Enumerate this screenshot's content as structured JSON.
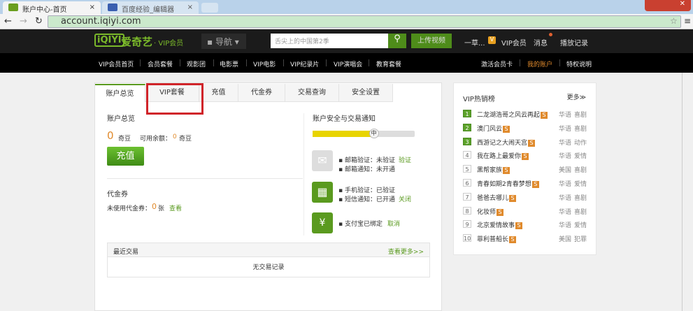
{
  "browser": {
    "tabs": [
      {
        "title": "账户中心-首页",
        "close": "×"
      },
      {
        "title": "百度经验_编辑器",
        "close": "×"
      }
    ],
    "url": "account.iqiyi.com"
  },
  "header": {
    "logo": "iQIYI",
    "brand": "爱奇艺",
    "vip": "· VIP会员",
    "nav_menu": "导航",
    "search_placeholder": "舌尖上的中国第2季",
    "upload": "上传视频",
    "user": "一草...",
    "vip_link": "VIP会员",
    "messages": "消息",
    "history": "播放记录"
  },
  "nav": {
    "items": [
      "VIP会员首页",
      "会员套餐",
      "观影团",
      "电影票",
      "VIP电影",
      "VIP纪录片",
      "VIP演唱会",
      "教育套餐"
    ],
    "right": [
      "激活会员卡",
      "我的账户",
      "特权说明"
    ]
  },
  "tabs": [
    "账户总览",
    "VIP套餐",
    "充值",
    "代金券",
    "交易查询",
    "安全设置"
  ],
  "overview": {
    "title": "账户总览",
    "balance": "0",
    "unit": "奇豆",
    "available_label": "可用余额：",
    "available": "0",
    "available_unit": "奇豆",
    "recharge": "充值"
  },
  "voucher": {
    "title": "代金券",
    "label": "未使用代金券：",
    "count": "0",
    "unit": "张",
    "view": "查看"
  },
  "security": {
    "title": "账户安全与交易通知",
    "level": "中",
    "level_pct": 60,
    "items": [
      [
        "邮箱验证：未验证",
        "邮箱通知：未开通"
      ],
      [
        "手机验证：已验证",
        "短信通知：已开通"
      ],
      [
        "支付宝已绑定"
      ]
    ],
    "actions": [
      "验证",
      "关闭",
      "取消"
    ]
  },
  "recent": {
    "title": "最近交易",
    "more": "查看更多>>",
    "empty": "无交易记录"
  },
  "ranking": {
    "title": "VIP热销榜",
    "more": "更多≫",
    "badge": "S",
    "items": [
      {
        "rank": "1",
        "name": "二龙湖浩哥之风云再起",
        "region": "华语",
        "genre": "喜剧"
      },
      {
        "rank": "2",
        "name": "澳门风云",
        "region": "华语",
        "genre": "喜剧"
      },
      {
        "rank": "3",
        "name": "西游记之大闹天宫",
        "region": "华语",
        "genre": "动作"
      },
      {
        "rank": "4",
        "name": "我在路上最爱你",
        "region": "华语",
        "genre": "爱情"
      },
      {
        "rank": "5",
        "name": "黑帮家族",
        "region": "美国",
        "genre": "喜剧"
      },
      {
        "rank": "6",
        "name": "青春如期2青春梦想",
        "region": "华语",
        "genre": "爱情"
      },
      {
        "rank": "7",
        "name": "爸爸去哪儿",
        "region": "华语",
        "genre": "喜剧"
      },
      {
        "rank": "8",
        "name": "化妆师",
        "region": "华语",
        "genre": "喜剧"
      },
      {
        "rank": "9",
        "name": "北京爱情故事",
        "region": "华语",
        "genre": "爱情"
      },
      {
        "rank": "10",
        "name": "菲利普船长",
        "region": "美国",
        "genre": "犯罪"
      }
    ]
  }
}
